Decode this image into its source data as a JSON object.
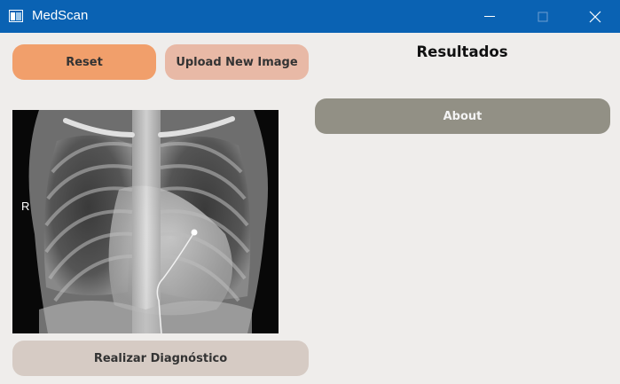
{
  "window": {
    "title": "MedScan",
    "controls": [
      "minimize-icon",
      "maximize-icon",
      "close-icon"
    ]
  },
  "left_panel": {
    "reset_label": "Reset",
    "upload_label": "Upload New Image",
    "image_marker": "R",
    "diagnose_label": "Realizar Diagnóstico"
  },
  "right_panel": {
    "results_title": "Resultados",
    "about_label": "About"
  },
  "colors": {
    "titlebar": "#0a62b3",
    "background": "#efedeb",
    "reset_button": "#f19f6b",
    "upload_button": "#e8b9a6",
    "diagnose_button": "#d6cbc4",
    "about_button": "#929085"
  }
}
